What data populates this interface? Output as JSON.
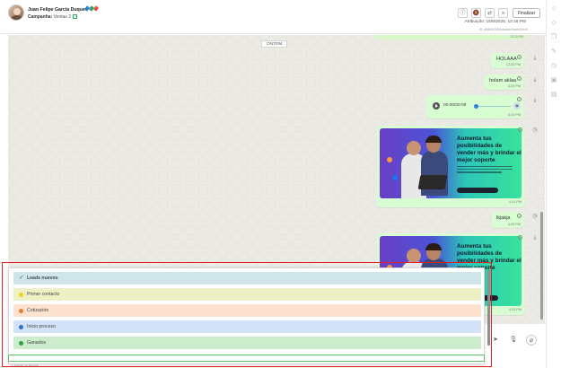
{
  "header": {
    "contact_name": "Juan Felipe Garcia Duque",
    "campaign_label": "Campanha:",
    "campaign_value": "Ventas 2",
    "tag_colors": [
      "#2a7de1",
      "#2ba36b",
      "#e8523f"
    ],
    "buttons": [
      "info-icon",
      "mute-icon",
      "transfer-icon",
      "forward-icon"
    ],
    "finalizar_label": "Finalizar",
    "atribuicao": "Atribuição: 15/8/2025, 12:16 PM",
    "id_text": "ID: 688f0b7839cba8d40ab0d2e40"
  },
  "sidebar": {
    "icons": [
      "user-icon",
      "tag-icon",
      "copy-icon",
      "edit-icon",
      "clock-icon",
      "image-icon",
      "document-icon"
    ]
  },
  "chat": {
    "date_separator": "ONTEM",
    "top_stub_time": "12:15 PM",
    "messages": [
      {
        "type": "text",
        "text": "HOLAAA",
        "time": "12:25 PM"
      },
      {
        "type": "text",
        "text": "holam  aklaa",
        "time": "4:24 PM"
      },
      {
        "type": "audio",
        "time_label": "00:00/00:09",
        "time": "4:24 PM"
      },
      {
        "type": "image",
        "headline": "Aumenta tus posibilidades de vender más y brindar el mejor soporte",
        "time": "4:24 PM"
      },
      {
        "type": "text",
        "text": "lkjakja",
        "time": "4:25 PM"
      },
      {
        "type": "image",
        "headline": "Aumenta tus posibilidades de vender más y brindar el mejor soporte",
        "time": "4:25 PM"
      }
    ]
  },
  "dropdown": {
    "options": [
      {
        "label": "Leads nuevos",
        "color": "#cfe5e8",
        "dot": "",
        "selected": true
      },
      {
        "label": "Primer contacto",
        "color": "#eef0c6",
        "dot": "#f0d21a",
        "selected": false
      },
      {
        "label": "Cotización",
        "color": "#fde3cf",
        "dot": "#f27a2a",
        "selected": false
      },
      {
        "label": "Inicio proceso",
        "color": "#d2e3f7",
        "dot": "#2c6fd6",
        "selected": false
      },
      {
        "label": "Ganados",
        "color": "#cdeccc",
        "dot": "#2ba34a",
        "selected": false
      }
    ],
    "input_placeholder": "Leads nuevos"
  },
  "composer": {
    "icons": [
      "send-icon",
      "mic-icon",
      "attach-icon"
    ]
  }
}
